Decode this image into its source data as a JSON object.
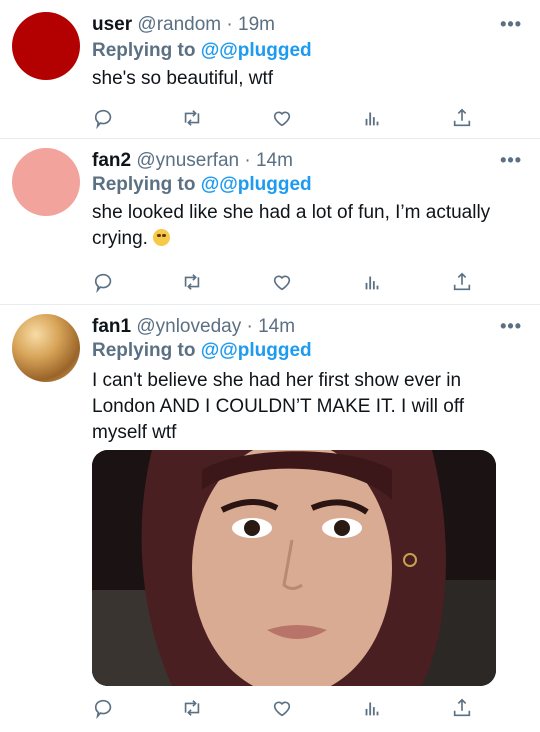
{
  "tweets": [
    {
      "name": "user",
      "handle": "@random",
      "time": "19m",
      "reply_label": "Replying to",
      "reply_to": "@@plugged",
      "text": "she's so beautiful, wtf",
      "avatar_color": "#b30000"
    },
    {
      "name": "fan2",
      "handle": "@ynuserfan",
      "time": "14m",
      "reply_label": "Replying to",
      "reply_to": "@@plugged",
      "text": "she looked like she had a lot of fun, I’m actually crying.",
      "emoji": "loudly-crying-face",
      "avatar_color": "#f2a39c"
    },
    {
      "name": "fan1",
      "handle": "@ynloveday",
      "time": "14m",
      "reply_label": "Replying to",
      "reply_to": "@@plugged",
      "text": "I can't believe she had her first show ever in London AND I COULDN’T MAKE IT. I will off myself wtf",
      "avatar_color": "#c9974a"
    }
  ],
  "separator": "·",
  "more_label": "•••",
  "actions": [
    "reply-icon",
    "retweet-icon",
    "like-icon",
    "analytics-icon",
    "share-icon"
  ],
  "colors": {
    "accent": "#1d9bf0",
    "muted": "#5b7083",
    "text": "#0f1419"
  }
}
